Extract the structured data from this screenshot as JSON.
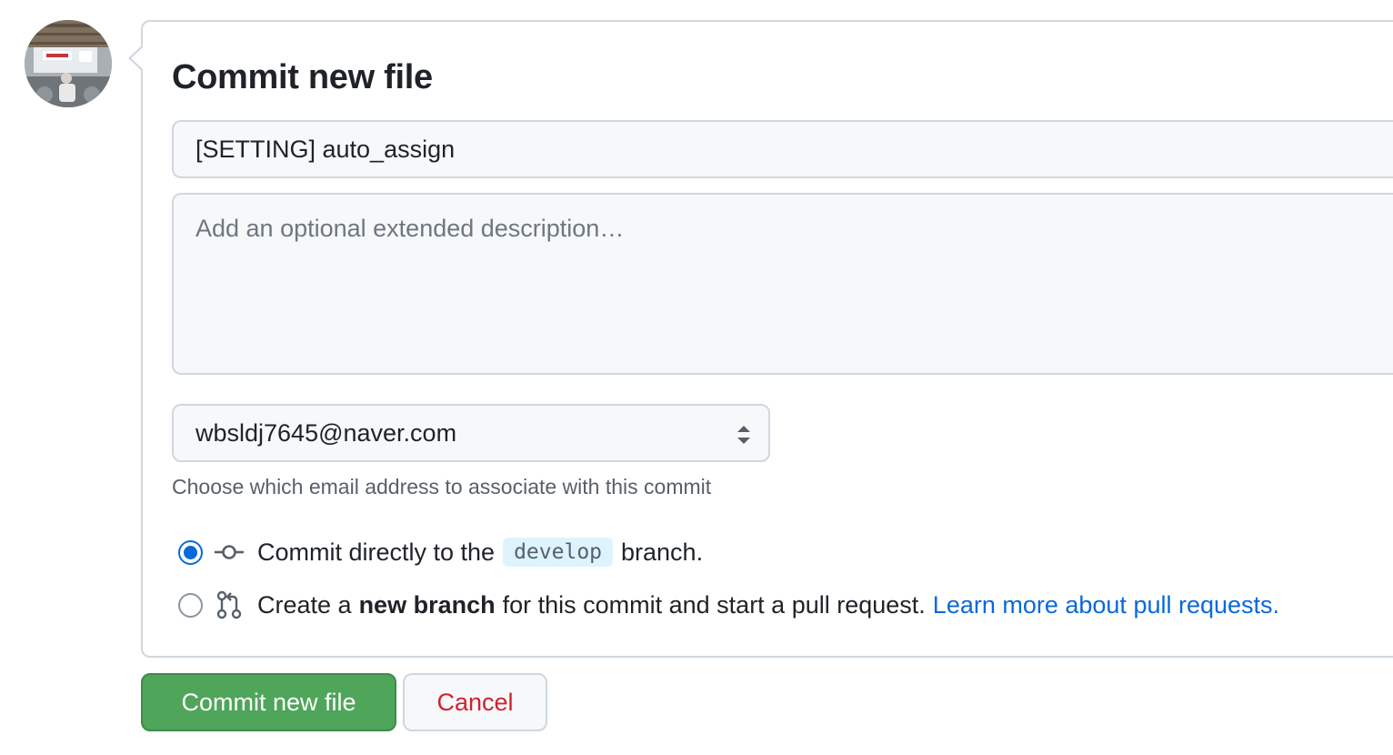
{
  "form": {
    "title": "Commit new file",
    "summary_value": "[SETTING] auto_assign",
    "description_placeholder": "Add an optional extended description…",
    "email": {
      "selected": "wbsldj7645@naver.com",
      "hint": "Choose which email address to associate with this commit"
    },
    "options": {
      "direct": {
        "prefix": "Commit directly to the",
        "branch": "develop",
        "suffix": "branch.",
        "checked": true
      },
      "new_branch": {
        "prefix": "Create a",
        "strong": "new branch",
        "suffix": "for this commit and start a pull request.",
        "link": "Learn more about pull requests.",
        "checked": false
      }
    }
  },
  "actions": {
    "commit_label": "Commit new file",
    "cancel_label": "Cancel"
  },
  "colors": {
    "primary_button": "#4fa55a",
    "cancel_text": "#cf222e",
    "accent": "#0969da"
  },
  "icons": {
    "avatar": "user-avatar",
    "commit": "git-commit-icon",
    "pull_request": "git-pull-request-icon",
    "select": "select-arrows-icon"
  }
}
